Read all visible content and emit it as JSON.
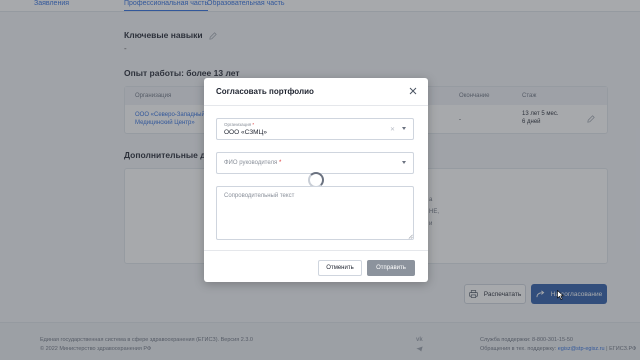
{
  "nav": {
    "left_link": "Заявления",
    "tabs": [
      {
        "label": "Профессиональная часть",
        "active": true
      },
      {
        "label": "Образовательная часть",
        "active": false
      }
    ]
  },
  "skills": {
    "title": "Ключевые навыки",
    "value": "-"
  },
  "work": {
    "title": "Опыт работы: более 13 лет",
    "columns": [
      "Организация",
      "Окончание",
      "Стаж"
    ],
    "rows": [
      {
        "org": "ООО «Северо-Западный Медицинский Центр»",
        "end": "-",
        "tenure_line1": "13 лет 5 мес.",
        "tenure_line2": "6 дней"
      }
    ]
  },
  "docs": {
    "title": "Дополнительные доку",
    "fragments": [
      "а",
      "НЕ,",
      "и"
    ]
  },
  "actions": {
    "print_label": "Распечатать",
    "approve_label": "На согласование"
  },
  "footer": {
    "line1": "Единая государственная система в сфере здравоохранения (ЕГИСЗ). Версия 2.3.0",
    "line2": "© 2022 Министерство здравоохранения РФ",
    "support_phone": "Служба поддержки: 8-800-301-15-50",
    "support_email_prefix": "Обращения в тех. поддержку:",
    "support_email": "egisz@stp-egisz.ru",
    "site": "ЕГИСЗ.РФ"
  },
  "modal": {
    "title": "Согласовать портфолио",
    "org_label": "Организация",
    "org_value": "ООО «СЗМЦ»",
    "fio_placeholder": "ФИО руководителя",
    "comment_placeholder": "Сопроводительный текст",
    "cancel_label": "Отменить",
    "send_label": "Отправить",
    "required_mark": "*"
  },
  "colors": {
    "accent": "#2d6cdf",
    "primary_button": "#2a5aa8",
    "disabled_button": "#8c939d",
    "overlay": "rgba(60,64,72,0.45)"
  },
  "icons": [
    "pencil-icon",
    "printer-icon",
    "share-arrow-icon",
    "close-icon",
    "chevron-down-icon",
    "spinner-icon",
    "vk-icon",
    "telegram-icon"
  ]
}
